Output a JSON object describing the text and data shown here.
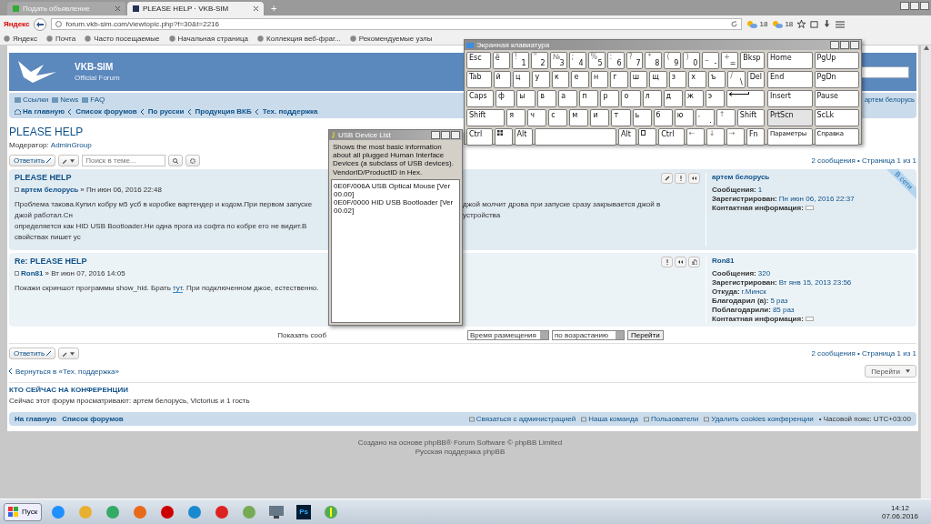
{
  "browser": {
    "tabs": [
      {
        "label": "Подать объявление",
        "selected": false
      },
      {
        "label": "PLEASE HELP · VKB-SIM",
        "selected": true
      }
    ],
    "new_tab": "+",
    "logo": "Яндекс",
    "url": "forum.vkb-sim.com/viewtopic.php?f=30&t=2216",
    "weather": [
      "18",
      "18"
    ],
    "bookmarks": [
      "Яндекс",
      "Почта",
      "Часто посещаемые",
      "Начальная страница",
      "Коллекция веб-фраг...",
      "Рекомендуемые узлы"
    ]
  },
  "forum": {
    "site_title": "VKB-SIM",
    "site_desc": "Official Forum",
    "quick_links": [
      "Ссылки",
      "News",
      "FAQ"
    ],
    "nav_user": "артем белорусь",
    "breadcrumbs": [
      "На главную",
      "Список форумов",
      "По русски",
      "Продукция ВКБ",
      "Тех. поддержка"
    ],
    "topic_title": "PLEASE HELP",
    "moderator_label": "Модератор:",
    "moderator": "AdminGroup",
    "reply_button_top": "Ответить",
    "search_placeholder": "Поиск в теме...",
    "pagination_top": "2 сообщения • Страница 1 из 1",
    "posts": [
      {
        "title": "PLEASE HELP",
        "author": "артем белорусь",
        "date": "» Пн июн 06, 2016 22:48",
        "body_left": [
          "Проблема такова.Купил кобру м5 усб в коробке вартендер и кодом.При первом запуске джой работал.Сн",
          "определяется как HID USB Bootloader.Ни одна прога из софта по кобре его не видит.В свойствах пишет ус"
        ],
        "body_right": "джой молчит дрова при запуске сразу закрывается джой в устройства",
        "online": "В сети",
        "buttons": [
          {
            "kind": "edit"
          },
          {
            "kind": "report"
          },
          {
            "kind": "quote"
          }
        ],
        "profile_name": "артем белорусь",
        "profile": [
          {
            "label": "Сообщения:",
            "value": "1"
          },
          {
            "label": "Зарегистрирован:",
            "value": "Пн июн 06, 2016 22:37"
          },
          {
            "label": "Контактная информация:"
          }
        ]
      },
      {
        "title": "Re: PLEASE HELP",
        "author": "Ron81",
        "date": "» Вт июн 07, 2016 14:05",
        "body": "Покажи скриншот программы show_hid. Брать ",
        "link": "тут",
        "body_after": ". При подключенном джое, естественно.",
        "buttons": [
          {
            "kind": "report"
          },
          {
            "kind": "quote"
          },
          {
            "kind": "thanks"
          }
        ],
        "profile_name": "Ron81",
        "profile": [
          {
            "label": "Сообщения:",
            "value": "320"
          },
          {
            "label": "Зарегистрирован:",
            "value": "Вт янв 15, 2013 23:56"
          },
          {
            "label": "Откуда:",
            "value": "г.Минск"
          },
          {
            "label": "Благодарил (а):",
            "value": "5 раз"
          },
          {
            "label": "Поблагодарили:",
            "value": "85 раз"
          },
          {
            "label": "Контактная информация:"
          }
        ]
      }
    ],
    "sort_label": "Показать сооб",
    "sort_by": "Время размещения",
    "sort_dir": "по возрастанию",
    "go_button": "Перейти",
    "reply_button_bottom": "Ответить",
    "pagination_bottom": "2 сообщения • Страница 1 из 1",
    "back_link": "Вернуться в «Тех. поддержка»",
    "jump_button": "Перейти",
    "online_title": "КТО СЕЙЧАС НА КОНФЕРЕНЦИИ",
    "online_text": "Сейчас этот форум просматривают: артем белорусь, Victorius и 1 гость",
    "footer_left": [
      "На главную",
      "Список форумов"
    ],
    "footer_right": [
      "Связаться с администрацией",
      "Наша команда",
      "Пользователи",
      "Удалить cookies конференции"
    ],
    "timezone": "• Часовой пояс: UTC+03:00",
    "credits": [
      "Создано на основе phpBB® Forum Software © phpBB Limited",
      "Русская поддержка phpBB"
    ]
  },
  "keyboard": {
    "title": "Экранная клавиатура",
    "rows": [
      {
        "keys": [
          {
            "kind": "wide",
            "main": "Esc"
          },
          {
            "kind": "key",
            "main": "ё"
          },
          {
            "kind": "key",
            "shift": "!",
            "main": "1"
          },
          {
            "kind": "key",
            "shift": "\"",
            "main": "2"
          },
          {
            "kind": "key",
            "shift": "№",
            "main": "3"
          },
          {
            "kind": "key",
            "shift": ";",
            "main": "4"
          },
          {
            "kind": "key",
            "shift": "%",
            "main": "5"
          },
          {
            "kind": "key",
            "shift": ":",
            "main": "6"
          },
          {
            "kind": "key",
            "shift": "?",
            "main": "7"
          },
          {
            "kind": "key",
            "shift": "*",
            "main": "8"
          },
          {
            "kind": "key",
            "shift": "(",
            "main": "9"
          },
          {
            "kind": "key",
            "shift": ")",
            "main": "0"
          },
          {
            "kind": "key",
            "shift": "_",
            "main": "-"
          },
          {
            "kind": "key",
            "shift": "+",
            "main": "="
          },
          {
            "kind": "wide",
            "main": "Bksp"
          }
        ]
      },
      {
        "keys": [
          {
            "kind": "wide",
            "main": "Tab"
          },
          {
            "kind": "key",
            "main": "й"
          },
          {
            "kind": "key",
            "main": "ц"
          },
          {
            "kind": "key",
            "main": "у"
          },
          {
            "kind": "key",
            "main": "к"
          },
          {
            "kind": "key",
            "main": "е"
          },
          {
            "kind": "key",
            "main": "н"
          },
          {
            "kind": "key",
            "main": "г"
          },
          {
            "kind": "key",
            "main": "ш"
          },
          {
            "kind": "key",
            "main": "щ"
          },
          {
            "kind": "key",
            "main": "з"
          },
          {
            "kind": "key",
            "main": "х"
          },
          {
            "kind": "key",
            "main": "ъ"
          },
          {
            "kind": "key",
            "shift": "/",
            "main": "\\"
          },
          {
            "kind": "key",
            "main": "Del"
          }
        ]
      },
      {
        "keys": [
          {
            "kind": "wide",
            "main": "Caps"
          },
          {
            "kind": "key",
            "main": "ф"
          },
          {
            "kind": "key",
            "main": "ы"
          },
          {
            "kind": "key",
            "main": "в"
          },
          {
            "kind": "key",
            "main": "а"
          },
          {
            "kind": "key",
            "main": "п"
          },
          {
            "kind": "key",
            "main": "р"
          },
          {
            "kind": "key",
            "main": "о"
          },
          {
            "kind": "key",
            "main": "л"
          },
          {
            "kind": "key",
            "main": "д"
          },
          {
            "kind": "key",
            "main": "ж"
          },
          {
            "kind": "key",
            "main": "э"
          },
          {
            "kind": "enter"
          }
        ]
      },
      {
        "keys": [
          {
            "kind": "wider",
            "main": "Shift"
          },
          {
            "kind": "key",
            "main": "я"
          },
          {
            "kind": "key",
            "main": "ч"
          },
          {
            "kind": "key",
            "main": "с"
          },
          {
            "kind": "key",
            "main": "м"
          },
          {
            "kind": "key",
            "main": "и"
          },
          {
            "kind": "key",
            "main": "т"
          },
          {
            "kind": "key",
            "main": "ь"
          },
          {
            "kind": "key",
            "main": "б"
          },
          {
            "kind": "key",
            "main": "ю"
          },
          {
            "kind": "key",
            "shift": ",",
            "main": "."
          },
          {
            "kind": "key",
            "shift": "↑"
          },
          {
            "kind": "wide",
            "main": "Shift"
          }
        ]
      },
      {
        "keys": [
          {
            "kind": "wide",
            "main": "Ctrl"
          },
          {
            "kind": "win"
          },
          {
            "kind": "key",
            "main": "Alt"
          },
          {
            "kind": "space"
          },
          {
            "kind": "key",
            "main": "Alt"
          },
          {
            "kind": "menu"
          },
          {
            "kind": "wide",
            "main": "Ctrl"
          },
          {
            "kind": "key",
            "shift": "←"
          },
          {
            "kind": "key",
            "shift": "↓"
          },
          {
            "kind": "key",
            "shift": "→"
          },
          {
            "kind": "key",
            "main": "Fn"
          }
        ]
      }
    ],
    "nav_keys": [
      "Home",
      "PgUp",
      "End",
      "PgDn",
      "Insert",
      "Pause",
      "PrtScn",
      "ScLk",
      "Параметры",
      "Справка"
    ]
  },
  "usb_dialog": {
    "title": "USB Device List",
    "description": "Shows the most basic information about all plugged Human Interface Devices (a subclass of USB devices). VendorID/ProductID in Hex.",
    "devices": [
      "0E0F/006A USB Optical Mouse [Ver 00.00]",
      "0E0F/0000 HID USB Bootloader [Ver 00.02]"
    ]
  },
  "taskbar": {
    "start": "Пуск",
    "ps_label": "Ps",
    "time": "14:12",
    "date": "07.06.2016"
  }
}
